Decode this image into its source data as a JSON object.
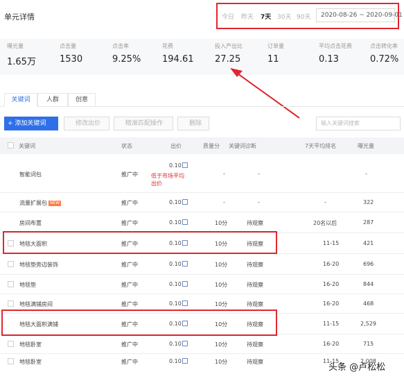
{
  "header": {
    "title": "单元详情",
    "ranges": [
      "今日",
      "昨天",
      "7天",
      "30天",
      "90天"
    ],
    "active_range": "7天",
    "date_range": "2020-08-26 ~ 2020-09-01"
  },
  "metrics": [
    {
      "label": "曝光量",
      "value": "1.65万"
    },
    {
      "label": "点击量",
      "value": "1530"
    },
    {
      "label": "点击率",
      "value": "9.25%"
    },
    {
      "label": "花费",
      "value": "194.61"
    },
    {
      "label": "投入产出比",
      "value": "27.25"
    },
    {
      "label": "订单量",
      "value": "11"
    },
    {
      "label": "平均点击花费",
      "value": "0.13"
    },
    {
      "label": "点击转化率",
      "value": "0.72%"
    }
  ],
  "tabs": [
    "关键词",
    "人群",
    "创意"
  ],
  "toolbar": {
    "add_keyword": "+ 添加关键词",
    "edit_bid": "修改出价",
    "exact_match": "精准匹配操作",
    "delete": "删除",
    "search_placeholder": "输入关键词搜索"
  },
  "table": {
    "headers": {
      "keyword": "关键词",
      "status": "状态",
      "bid": "出价",
      "quality": "质量分",
      "diagnosis": "关键词诊断",
      "rank": "7天平均排名",
      "impressions": "曝光量"
    },
    "rows": [
      {
        "keyword": "智能词包",
        "status": "推广中",
        "bid": "0.10",
        "note": "低于市场平均出价",
        "quality": "-",
        "diagnosis": "-",
        "rank": "",
        "impressions": "-"
      },
      {
        "keyword": "流量扩展包",
        "badge": "NEW",
        "status": "推广中",
        "bid": "0.10",
        "quality": "-",
        "diagnosis": "-",
        "rank": "-",
        "impressions": "322"
      },
      {
        "keyword": "房间布置",
        "status": "推广中",
        "bid": "0.10",
        "quality": "10分",
        "diagnosis": "待观察",
        "rank": "20名以后",
        "impressions": "287"
      },
      {
        "keyword": "地毯大面积",
        "status": "推广中",
        "bid": "0.10",
        "quality": "10分",
        "diagnosis": "待观察",
        "rank": "11-15",
        "impressions": "421"
      },
      {
        "keyword": "地毯垫旁边装饰",
        "status": "推广中",
        "bid": "0.10",
        "quality": "10分",
        "diagnosis": "待观察",
        "rank": "16-20",
        "impressions": "696"
      },
      {
        "keyword": "地毯垫",
        "status": "推广中",
        "bid": "0.10",
        "quality": "10分",
        "diagnosis": "待观察",
        "rank": "16-20",
        "impressions": "844"
      },
      {
        "keyword": "地毯满铺房间",
        "status": "推广中",
        "bid": "0.10",
        "quality": "10分",
        "diagnosis": "待观察",
        "rank": "16-20",
        "impressions": "468"
      },
      {
        "keyword": "地毯大面积满铺",
        "status": "推广中",
        "bid": "0.10",
        "quality": "10分",
        "diagnosis": "待观察",
        "rank": "11-15",
        "impressions": "2,529"
      },
      {
        "keyword": "地毯卧室",
        "status": "推广中",
        "bid": "0.10",
        "quality": "10分",
        "diagnosis": "待观察",
        "rank": "16-20",
        "impressions": "715"
      },
      {
        "keyword": "地毯卧室",
        "status": "推广中",
        "bid": "0.10",
        "quality": "10分",
        "diagnosis": "待观察",
        "rank": "11-15",
        "impressions": "2,008"
      }
    ]
  },
  "watermark": "头条 @卢松松",
  "colors": {
    "highlight": "#e0262f",
    "primary": "#2f6fe8"
  }
}
